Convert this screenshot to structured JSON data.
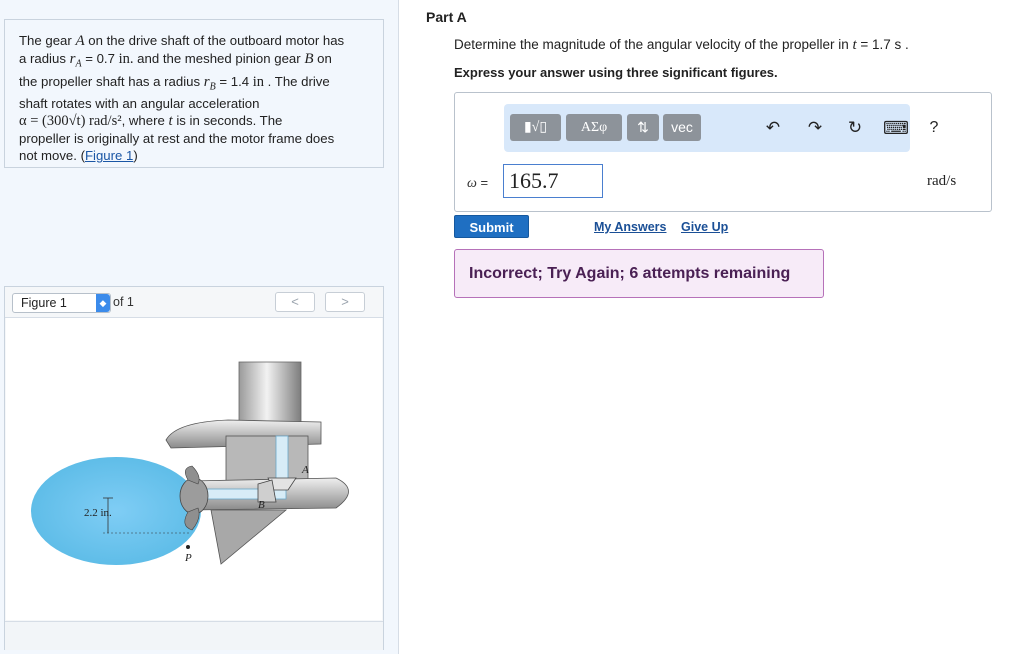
{
  "problem": {
    "line1a": "The gear ",
    "gear_a": "A",
    "line1b": " on the drive shaft of the outboard motor has",
    "line2a": "a radius ",
    "ra_var": "r",
    "ra_sub": "A",
    "ra_value": " = 0.7 ",
    "ra_unit": "in.",
    "line2b": " and the meshed pinion gear ",
    "gear_b": "B",
    "line2c": " on",
    "line3a": "the propeller shaft has a radius ",
    "rb_var": "r",
    "rb_sub": "B",
    "rb_value": " = 1.4 ",
    "rb_unit": "in",
    "line3b": " . The drive",
    "line4": "shaft rotates with an angular acceleration",
    "alpha": "α = (300√t) rad/s²",
    "line5b": ", where ",
    "t_var": "t",
    "line5c": " is in seconds. The",
    "line6": "propeller is originally at rest and the motor frame does",
    "line7a": "not move. (",
    "figure_link": "Figure 1",
    "line7b": ")"
  },
  "figure": {
    "select_value": "Figure 1",
    "of_text": "of 1",
    "prev": "<",
    "next": ">",
    "label_a": "A",
    "label_b": "B",
    "label_p": "P",
    "label_dim": "2.2 in."
  },
  "part": {
    "title": "Part A",
    "question_a": "Determine the magnitude of the angular velocity of the propeller in ",
    "question_t": "t",
    "question_b": " = 1.7  s .",
    "instruction": "Express your answer using three significant figures."
  },
  "toolbar": {
    "templates": "▮√▯",
    "greek": "ΑΣφ",
    "arrows": "⇅",
    "vec": "vec",
    "undo": "↶",
    "redo": "↷",
    "reset": "↻",
    "keyboard": "⌨",
    "help": "?"
  },
  "answer": {
    "label_var": "ω",
    "label_eq": " =",
    "value": "165.7",
    "units": "rad/s"
  },
  "actions": {
    "submit": "Submit",
    "my_answers": "My Answers",
    "give_up": "Give Up"
  },
  "feedback": {
    "text": "Incorrect; Try Again; 6 attempts remaining"
  },
  "colors": {
    "accent": "#1f6fc2",
    "feedback_bg": "#f7ebf8",
    "feedback_border": "#b671b9",
    "toolbar_bg": "#d8e8fa"
  }
}
